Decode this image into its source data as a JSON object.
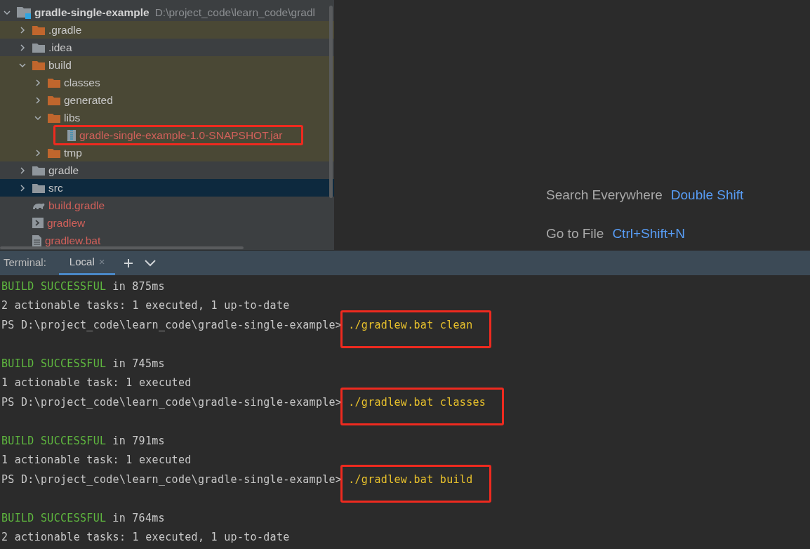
{
  "project_tree": {
    "root": {
      "name": "gradle-single-example",
      "path": "D:\\project_code\\learn_code\\gradl",
      "expanded": true
    },
    "items": [
      {
        "name": ".gradle",
        "kind": "folder",
        "unversioned": false,
        "excluded": true,
        "expanded": false,
        "selected": false
      },
      {
        "name": ".idea",
        "kind": "folder",
        "unversioned": false,
        "excluded": false,
        "expanded": false,
        "selected": false
      },
      {
        "name": "build",
        "kind": "folder",
        "unversioned": false,
        "excluded": true,
        "expanded": true,
        "selected": false,
        "children": [
          {
            "name": "classes",
            "kind": "folder",
            "unversioned": false,
            "excluded": true,
            "expanded": false,
            "selected": false
          },
          {
            "name": "generated",
            "kind": "folder",
            "unversioned": false,
            "excluded": true,
            "expanded": false,
            "selected": false
          },
          {
            "name": "libs",
            "kind": "folder",
            "unversioned": false,
            "excluded": true,
            "expanded": true,
            "selected": false,
            "children": [
              {
                "name": "gradle-single-example-1.0-SNAPSHOT.jar",
                "kind": "jar",
                "unversioned": true,
                "excluded": true,
                "selected": false,
                "annotated": true
              }
            ]
          },
          {
            "name": "tmp",
            "kind": "folder",
            "unversioned": false,
            "excluded": true,
            "expanded": false,
            "selected": false
          }
        ]
      },
      {
        "name": "gradle",
        "kind": "folder",
        "unversioned": false,
        "excluded": false,
        "expanded": false,
        "selected": false
      },
      {
        "name": "src",
        "kind": "folder",
        "unversioned": false,
        "excluded": false,
        "expanded": false,
        "selected": true
      },
      {
        "name": "build.gradle",
        "kind": "gradle",
        "unversioned": true,
        "excluded": false,
        "selected": false
      },
      {
        "name": "gradlew",
        "kind": "script",
        "unversioned": true,
        "excluded": false,
        "selected": false
      },
      {
        "name": "gradlew.bat",
        "kind": "text",
        "unversioned": true,
        "excluded": false,
        "selected": false
      }
    ]
  },
  "hints": [
    {
      "label": "Search Everywhere",
      "shortcut": "Double Shift"
    },
    {
      "label": "Go to File",
      "shortcut": "Ctrl+Shift+N"
    }
  ],
  "terminal": {
    "title": "Terminal:",
    "tabs": [
      {
        "label": "Local",
        "selected": true,
        "close": "×"
      }
    ],
    "lines": [
      {
        "kind": "status",
        "status": "BUILD SUCCESSFUL",
        "text": "in 875ms"
      },
      {
        "kind": "text",
        "text": "2 actionable tasks: 1 executed, 1 up-to-date"
      },
      {
        "kind": "prompt",
        "prompt": "PS D:\\project_code\\learn_code\\gradle-single-example>",
        "command": "./gradlew.bat clean",
        "annotated": true
      },
      {
        "kind": "blank"
      },
      {
        "kind": "status",
        "status": "BUILD SUCCESSFUL",
        "text": "in 745ms"
      },
      {
        "kind": "text",
        "text": "1 actionable task: 1 executed"
      },
      {
        "kind": "prompt",
        "prompt": "PS D:\\project_code\\learn_code\\gradle-single-example>",
        "command": "./gradlew.bat classes",
        "annotated": true
      },
      {
        "kind": "blank"
      },
      {
        "kind": "status",
        "status": "BUILD SUCCESSFUL",
        "text": "in 791ms"
      },
      {
        "kind": "text",
        "text": "1 actionable task: 1 executed"
      },
      {
        "kind": "prompt",
        "prompt": "PS D:\\project_code\\learn_code\\gradle-single-example>",
        "command": "./gradlew.bat build",
        "annotated": true
      },
      {
        "kind": "blank"
      },
      {
        "kind": "status",
        "status": "BUILD SUCCESSFUL",
        "text": "in 764ms"
      },
      {
        "kind": "text",
        "text": "2 actionable tasks: 1 executed, 1 up-to-date"
      }
    ]
  }
}
